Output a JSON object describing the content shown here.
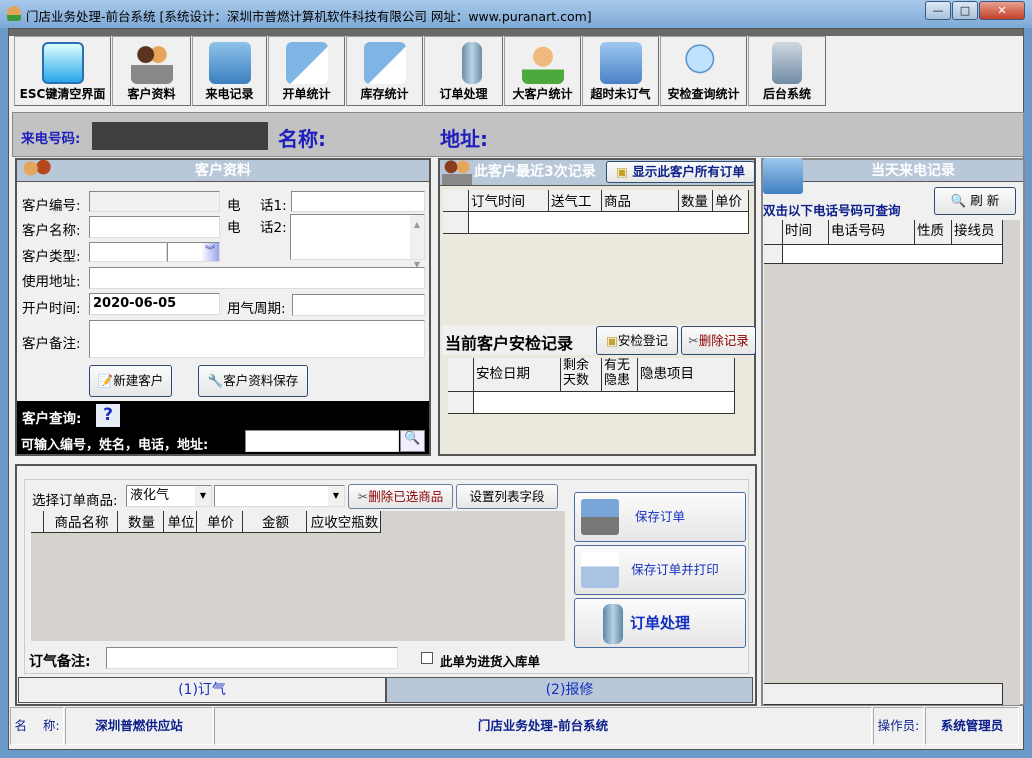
{
  "window": {
    "title": "门店业务处理-前台系统  [系统设计：深圳市普燃计算机软件科技有限公司  网址：www.puranart.com]",
    "controls": [
      "minimize",
      "maximize",
      "close"
    ]
  },
  "toolbar": [
    {
      "label": "ESC键清空界面",
      "icon": "window-icon"
    },
    {
      "label": "客户资料",
      "icon": "users-icon"
    },
    {
      "label": "来电记录",
      "icon": "phone-icon"
    },
    {
      "label": "开单统计",
      "icon": "calculator-icon"
    },
    {
      "label": "库存统计",
      "icon": "calculator-icon"
    },
    {
      "label": "订单处理",
      "icon": "gas-cylinder-icon"
    },
    {
      "label": "大客户统计",
      "icon": "user-icon"
    },
    {
      "label": "超时未订气",
      "icon": "group-icon"
    },
    {
      "label": "安检查询统计",
      "icon": "magnifier-icon"
    },
    {
      "label": "后台系统",
      "icon": "network-icon"
    }
  ],
  "caller": {
    "phone_label": "来电号码:",
    "phone_value": "",
    "name_label": "名称:",
    "address_label": "地址:"
  },
  "customer": {
    "title": "客户资料",
    "id_label": "客户编号:",
    "name_label": "客户名称:",
    "type_label": "客户类型:",
    "addr_label": "使用地址:",
    "open_label": "开户时间:",
    "open_value": "2020-06-05",
    "cycle_label": "用气周期:",
    "note_label": "客户备注:",
    "phone1_label_a": "电",
    "phone1_label_b": "话1:",
    "phone2_label_a": "电",
    "phone2_label_b": "话2:",
    "new_btn": "新建客户",
    "save_btn": "客户资料保存",
    "query_label": "客户查询:",
    "query_help": "?",
    "search_label": "可输入编号，姓名，电话，地址:",
    "search_value": ""
  },
  "recent": {
    "title": "此客户最近3次记录",
    "show_all_btn": "显示此客户所有订单",
    "columns": [
      "订气时间",
      "送气工",
      "商品",
      "数量",
      "单价"
    ]
  },
  "safety": {
    "title": "当前客户安检记录",
    "register_btn": "安检登记",
    "delete_btn": "删除记录",
    "columns": [
      "安检日期",
      "剩余天数",
      "有无隐患",
      "隐患项目"
    ]
  },
  "calls": {
    "title": "当天来电记录",
    "hint": "双击以下电话号码可查询",
    "refresh_btn": "刷 新",
    "columns": [
      "时间",
      "电话号码",
      "性质",
      "接线员"
    ]
  },
  "order": {
    "product_label": "选择订单商品:",
    "product_value": "液化气",
    "product2_value": "",
    "delete_btn": "删除已选商品",
    "columns_btn": "设置列表字段",
    "columns": [
      "商品名称",
      "数量",
      "单位",
      "单价",
      "金额",
      "应收空瓶数"
    ],
    "save_btn": "保存订单",
    "save_print_btn": "保存订单并打印",
    "process_btn": "订单处理",
    "note_label": "订气备注:",
    "note_value": "",
    "stock_checkbox": "此单为进货入库单",
    "stock_checked": false,
    "tabs": [
      "(1)订气",
      "(2)报修"
    ],
    "active_tab": 0
  },
  "status": {
    "name_label": "名    称:",
    "name_value": "深圳普燃供应站",
    "app": "门店业务处理-前台系统",
    "operator_label": "操作员:",
    "operator_value": "系统管理员"
  }
}
